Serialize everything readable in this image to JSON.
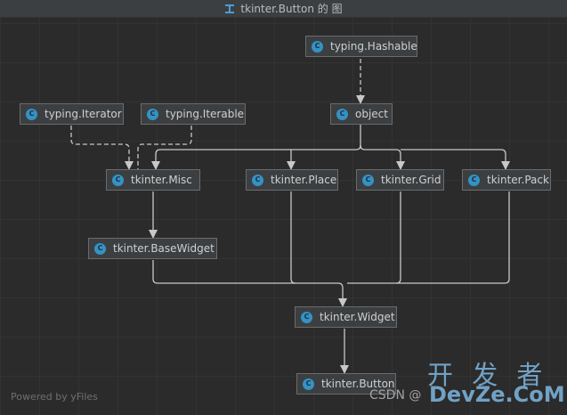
{
  "window": {
    "title": "tkinter.Button 的 图"
  },
  "nodes": {
    "hashable": "typing.Hashable",
    "object": "object",
    "iterator": "typing.Iterator",
    "iterable": "typing.Iterable",
    "misc": "tkinter.Misc",
    "place": "tkinter.Place",
    "grid": "tkinter.Grid",
    "pack": "tkinter.Pack",
    "basewidget": "tkinter.BaseWidget",
    "widget": "tkinter.Widget",
    "button": "tkinter.Button"
  },
  "class_icon_letter": "C",
  "footer": {
    "powered_by": "Powered by yFiles"
  },
  "watermark": {
    "big": "开 发 者",
    "small": "CSDN @",
    "domain": "DevZe.CoM"
  },
  "colors": {
    "class_icon": "#3592c4",
    "edge": "#c8c8c8",
    "node_bg": "#3c3f41"
  }
}
